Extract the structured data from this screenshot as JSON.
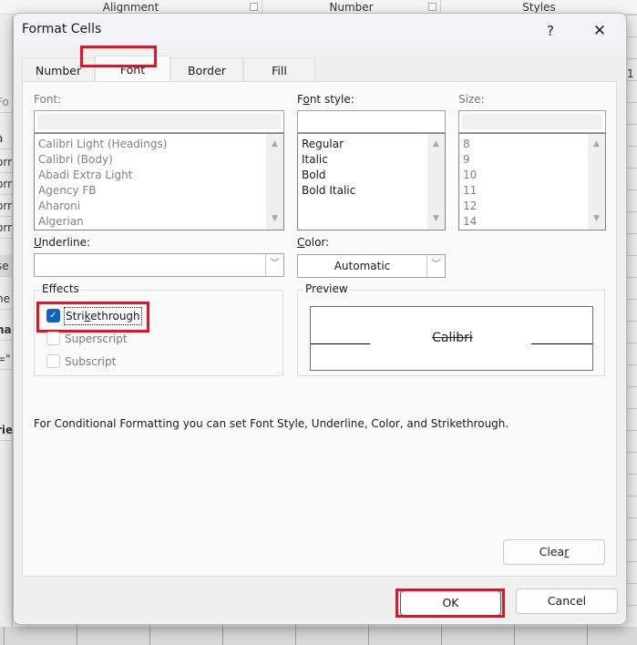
{
  "background": {
    "ribbon_groups": [
      {
        "label": "Alignment"
      },
      {
        "label": "Number"
      },
      {
        "label": "Styles"
      }
    ],
    "left_fragments": [
      "Fo",
      "a",
      "orm",
      "orm",
      "orm",
      "orm",
      "se",
      "ne",
      "na",
      "=\"",
      "rie"
    ],
    "right_fragment": "1"
  },
  "dialog": {
    "title": "Format Cells",
    "help_label": "?",
    "close_label": "✕",
    "tabs": [
      {
        "label": "Number",
        "active": false
      },
      {
        "label": "Font",
        "active": true
      },
      {
        "label": "Border",
        "active": false
      },
      {
        "label": "Fill",
        "active": false
      }
    ],
    "highlight_color": "#e81123",
    "font": {
      "label": "Font:",
      "value": "",
      "items": [
        "Calibri Light (Headings)",
        "Calibri (Body)",
        "Abadi Extra Light",
        "Agency FB",
        "Aharoni",
        "Algerian"
      ]
    },
    "font_style": {
      "label_pre": "F",
      "label_u": "o",
      "label_post": "nt style:",
      "value": "",
      "items": [
        "Regular",
        "Italic",
        "Bold",
        "Bold Italic"
      ]
    },
    "size": {
      "label": "Size:",
      "value": "",
      "items": [
        "8",
        "9",
        "10",
        "11",
        "12",
        "14"
      ]
    },
    "underline": {
      "label_u": "U",
      "label_post": "nderline:",
      "value": ""
    },
    "color": {
      "label_u": "C",
      "label_post": "olor:",
      "value": "Automatic"
    },
    "effects": {
      "legend": "Effects",
      "strikethrough": {
        "pre": "Stri",
        "u": "k",
        "post": "ethrough",
        "checked": true
      },
      "superscript": {
        "label": "Superscript",
        "checked": false
      },
      "subscript": {
        "label": "Subscript",
        "checked": false
      }
    },
    "preview": {
      "legend": "Preview",
      "sample": "Calibri"
    },
    "info_text": "For Conditional Formatting you can set Font Style, Underline, Color, and Strikethrough.",
    "clear": {
      "pre": "Clea",
      "u": "r"
    },
    "ok_label": "OK",
    "cancel_label": "Cancel"
  }
}
